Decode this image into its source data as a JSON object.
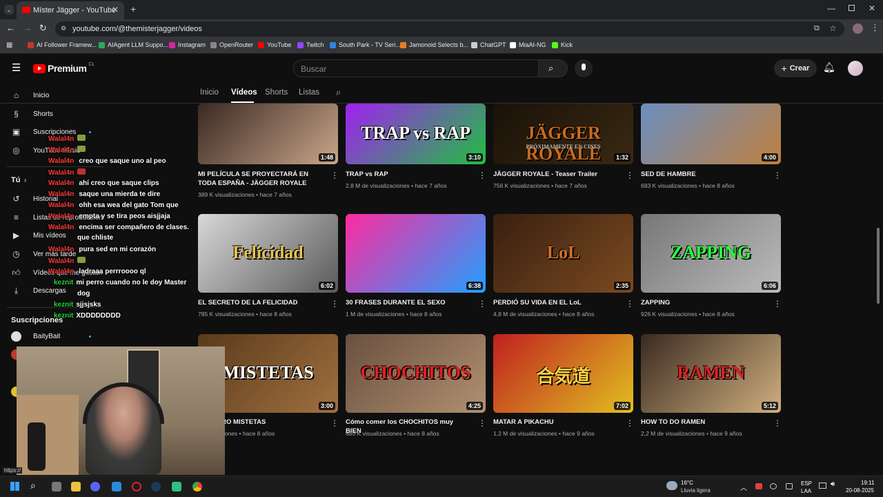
{
  "browser": {
    "tab_title": "Míster Jägger - YouTube",
    "url": "youtube.com/@themisterjagger/videos",
    "bookmarks": [
      {
        "label": "AI Follower Framew...",
        "color": "#c0392b"
      },
      {
        "label": "AIAgent LLM Suppo...",
        "color": "#27ae60"
      },
      {
        "label": "Instagram",
        "color": "#d6249f"
      },
      {
        "label": "OpenRouter",
        "color": "#888888"
      },
      {
        "label": "YouTube",
        "color": "#ff0000"
      },
      {
        "label": "Twitch",
        "color": "#9146ff"
      },
      {
        "label": "South Park - TV Seri...",
        "color": "#2e86de"
      },
      {
        "label": "Jamonoid Selects b...",
        "color": "#e67e22"
      },
      {
        "label": "ChatGPT",
        "color": "#cccccc"
      },
      {
        "label": "MiaAI-NG",
        "color": "#ffffff"
      },
      {
        "label": "Kick",
        "color": "#53fc18"
      }
    ]
  },
  "header": {
    "logo_text": "Premium",
    "region": "CL",
    "search_placeholder": "Buscar",
    "create_label": "Crear"
  },
  "channel_tabs": [
    "Inicio",
    "Vídeos",
    "Shorts",
    "Listas"
  ],
  "sidebar": {
    "items": [
      "Inicio",
      "Shorts",
      "Suscripciones",
      "YouTube Music"
    ],
    "you_label": "Tú",
    "you_items": [
      "Historial",
      "Listas de reproducción",
      "Mis vídeos",
      "Ver más tarde",
      "Vídeos que me gustan",
      "Descargas"
    ],
    "subs_heading": "Suscripciones",
    "subs": [
      "BaityBait"
    ]
  },
  "videos": [
    {
      "title": "MI PELÍCULA SE PROYECTARÁ EN TODA ESPAÑA - JÄGGER ROYALE",
      "views": "389 K visualizaciones",
      "age": "hace 7 años",
      "duration": "1:48",
      "thumb_text": "",
      "colors": [
        "#3a2a22",
        "#c9a58a"
      ]
    },
    {
      "title": "TRAP vs RAP",
      "views": "2,8 M de visualizaciones",
      "age": "hace 7 años",
      "duration": "3:10",
      "thumb_text": "TRAP vs RAP",
      "colors": [
        "#a020f0",
        "#20c040"
      ]
    },
    {
      "title": "JÄGGER ROYALE - Teaser Trailer",
      "views": "756 K visualizaciones",
      "age": "hace 7 años",
      "duration": "1:32",
      "thumb_text": "JÄGGER ROYALE",
      "subtext": "PRÓXIMAMENTE EN CINES",
      "colors": [
        "#1a1208",
        "#3a2812"
      ]
    },
    {
      "title": "SED DE HAMBRE",
      "views": "683 K visualizaciones",
      "age": "hace 8 años",
      "duration": "4:00",
      "thumb_text": "",
      "colors": [
        "#6a8ec0",
        "#c08040"
      ]
    },
    {
      "title": "EL SECRETO DE LA FELICIDAD",
      "views": "785 K visualizaciones",
      "age": "hace 8 años",
      "duration": "6:02",
      "thumb_text": "Felicidad",
      "colors": [
        "#d8d8d8",
        "#5a5a5a"
      ]
    },
    {
      "title": "30 FRASES DURANTE EL SEXO",
      "views": "1 M de visualizaciones",
      "age": "hace 8 años",
      "duration": "6:38",
      "thumb_text": "",
      "colors": [
        "#ff2aa0",
        "#20a0ff"
      ]
    },
    {
      "title": "PERDIÓ SU VIDA EN EL LoL",
      "views": "4,8 M de visualizaciones",
      "age": "hace 8 años",
      "duration": "2:35",
      "thumb_text": "LoL",
      "colors": [
        "#3a2010",
        "#7a4a20"
      ]
    },
    {
      "title": "ZAPPING",
      "views": "926 K visualizaciones",
      "age": "hace 8 años",
      "duration": "6:06",
      "thumb_text": "ZAPPING",
      "colors": [
        "#777777",
        "#bbbbbb"
      ]
    },
    {
      "title": "EL PERRO MISTETAS",
      "views": "visualizaciones",
      "age": "hace 8 años",
      "duration": "3:00",
      "thumb_text": "MISTETAS",
      "colors": [
        "#5a3a1a",
        "#a07040"
      ]
    },
    {
      "title": "Cómo comer los CHOCHITOS muy BIEN",
      "views": "685 K visualizaciones",
      "age": "hace 8 años",
      "duration": "4:25",
      "thumb_text": "CHOCHITOS",
      "colors": [
        "#6a5040",
        "#b09070"
      ]
    },
    {
      "title": "MATAR A PIKACHU",
      "views": "1,2 M de visualizaciones",
      "age": "hace 9 años",
      "duration": "7:02",
      "thumb_text": "合気道",
      "colors": [
        "#c02020",
        "#e0c020"
      ]
    },
    {
      "title": "HOW TO DO RAMEN",
      "views": "2,2 M de visualizaciones",
      "age": "hace 9 años",
      "duration": "5:12",
      "thumb_text": "RAMEN",
      "colors": [
        "#3a2a20",
        "#d0b080"
      ]
    }
  ],
  "chat": [
    {
      "user": "Walal4n",
      "msg": "creo que saque uno al peo"
    },
    {
      "user": "Walal4n",
      "msg": "ahí creo que saque clips"
    },
    {
      "user": "Walal4n",
      "msg": "saque una mierda te dire"
    },
    {
      "user": "Walal4n",
      "msg": "ohh esa wea del gato Tom que"
    },
    {
      "user": "Walal4n",
      "msg": "empta y se tira peos aisjjaja"
    },
    {
      "user": "Walal4n",
      "msg": "encima ser compañero de clases."
    },
    {
      "user": "",
      "msg": "que chliste"
    },
    {
      "user": "Walal4n",
      "msg": "pura sed en mi corazón"
    },
    {
      "user": "Walal4n",
      "msg": "ladraaa perrroooo ql"
    },
    {
      "user": "keznit",
      "msg": "mi perro cuando no le doy Master"
    },
    {
      "user": "",
      "msg": "dog"
    },
    {
      "user": "keznit",
      "msg": "sjjsjsks"
    },
    {
      "user": "keznit",
      "msg": "XDDDDDDDD"
    }
  ],
  "status_url": "https://",
  "taskbar": {
    "weather_temp": "16°C",
    "weather_desc": "Lluvia ligera",
    "lang": "ESP",
    "lang2": "LAA",
    "time": "19:11",
    "date": "20-08-2025"
  }
}
